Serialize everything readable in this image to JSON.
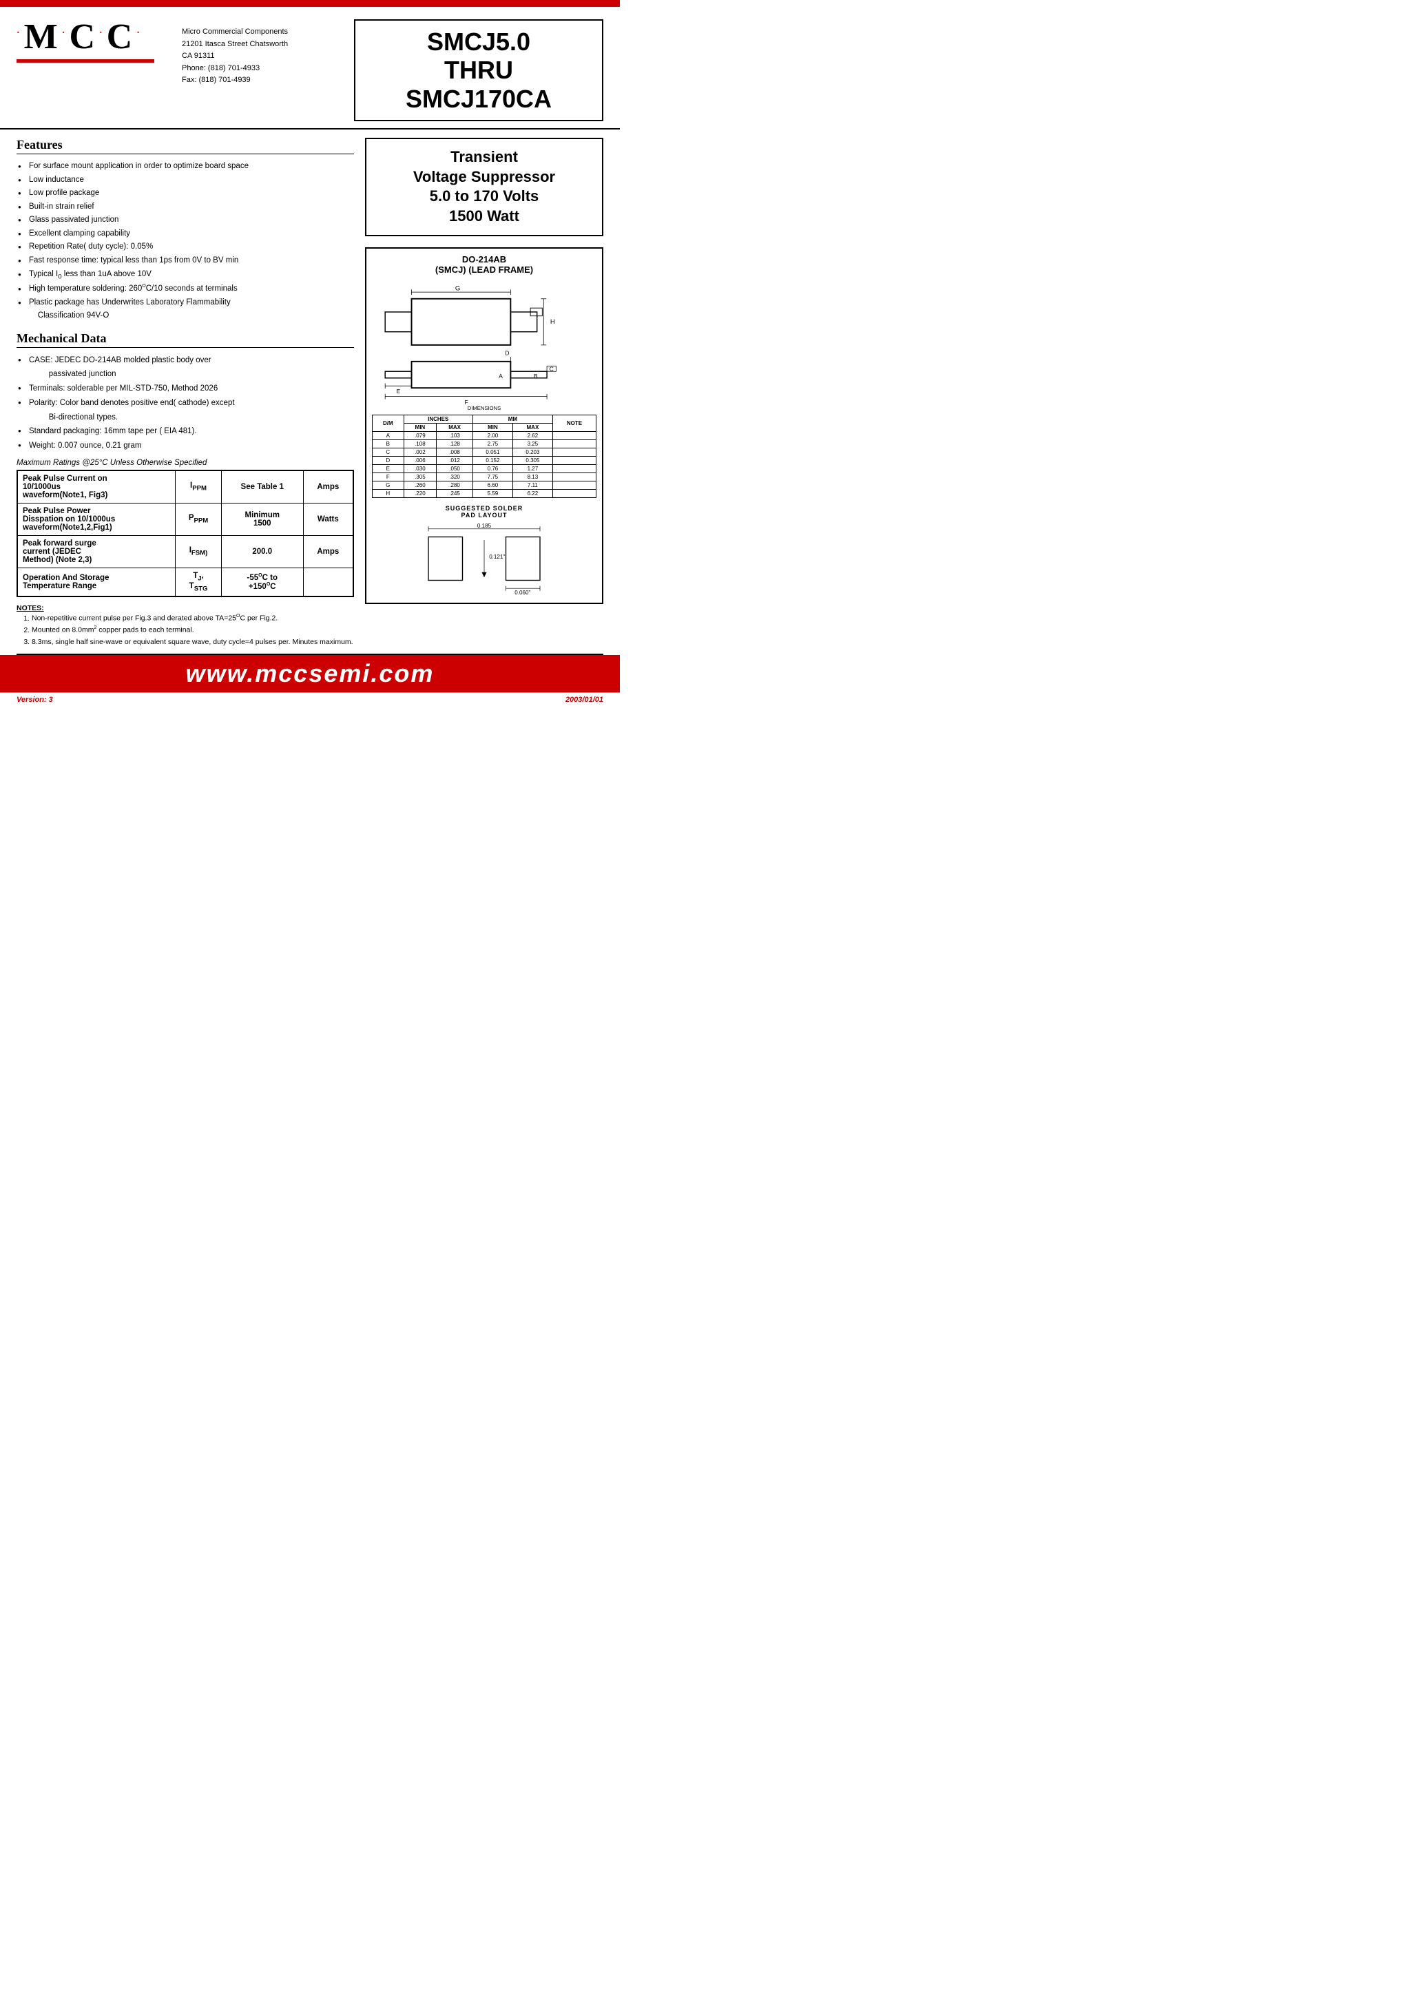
{
  "page": {
    "top_bar_color": "#cc0000",
    "logo": {
      "text": "M·C·C·"
    },
    "company": {
      "name": "Micro Commercial Components",
      "address1": "21201 Itasca Street Chatsworth",
      "address2": "CA 91311",
      "phone": "Phone: (818) 701-4933",
      "fax": "Fax:    (818) 701-4939"
    },
    "part_number": {
      "title": "SMCJ5.0\nTHRU\nSMCJ170CA"
    },
    "tvs": {
      "title": "Transient\nVoltage Suppressor\n5.0 to 170 Volts\n1500 Watt"
    },
    "package": {
      "title": "DO-214AB",
      "subtitle": "(SMCJ) (LEAD FRAME)"
    },
    "features": {
      "title": "Features",
      "items": [
        "For surface mount application in order to optimize board space",
        "Low inductance",
        "Low profile package",
        "Built-in strain relief",
        "Glass passivated junction",
        "Excellent clamping capability",
        "Repetition Rate( duty cycle): 0.05%",
        "Fast response time: typical less than 1ps from 0V to BV min",
        "Typical I₀ less than 1uA above 10V",
        "High temperature soldering: 260°C/10 seconds at terminals",
        "Plastic package has Underwrites Laboratory Flammability Classification 94V-O"
      ]
    },
    "mechanical": {
      "title": "Mechanical Data",
      "items": [
        "CASE: JEDEC DO-214AB molded plastic body over passivated junction",
        "Terminals:  solderable per MIL-STD-750, Method 2026",
        "Polarity: Color band denotes positive end( cathode) except Bi-directional types.",
        "Standard packaging: 16mm tape per ( EIA 481).",
        "Weight: 0.007 ounce, 0.21 gram"
      ]
    },
    "max_ratings_header": "Maximum Ratings @25°C Unless Otherwise Specified",
    "ratings_table": {
      "rows": [
        {
          "label1": "Peak Pulse Current on",
          "label2": "10/1000us",
          "label3": "waveform(Note1, Fig3)",
          "symbol": "Iₚₚₘ",
          "value": "See Table 1",
          "unit": "Amps"
        },
        {
          "label1": "Peak Pulse Power",
          "label2": "Disspation on 10/1000us",
          "label3": "waveform(Note1,2,Fig1)",
          "symbol": "Pₚₚₘ",
          "value": "Minimum\n1500",
          "unit": "Watts"
        },
        {
          "label1": "Peak forward surge",
          "label2": "current (JEDEC",
          "label3": "Method) (Note 2,3)",
          "symbol": "Iₜₛₘ₍",
          "value": "200.0",
          "unit": "Amps"
        },
        {
          "label1": "Operation And Storage",
          "label2": "Temperature Range",
          "label3": "",
          "symbol": "Tⱼ,\nTₛₜᵍ",
          "value": "-55°C to\n+150°C",
          "unit": ""
        }
      ]
    },
    "notes": {
      "title": "NOTES:",
      "items": [
        "Non-repetitive current pulse per Fig.3 and derated above TA=25°C per Fig.2.",
        "Mounted on 8.0mm² copper pads to each terminal.",
        "8.3ms, single half sine-wave or equivalent square wave, duty cycle=4 pulses per. Minutes maximum."
      ]
    },
    "dimensions_table": {
      "headers": [
        "D/M",
        "INCHES MIN",
        "INCHES MAX",
        "MM MIN",
        "MM MAX",
        "NOTE"
      ],
      "rows": [
        [
          "A",
          ".079",
          ".103",
          "2.00",
          "2.62",
          ""
        ],
        [
          "B",
          ".108",
          ".128",
          "2.75",
          "3.25",
          ""
        ],
        [
          "C",
          ".002",
          ".008",
          "0.051",
          "0.203",
          ""
        ],
        [
          "D",
          ".006",
          ".012",
          "0.152",
          "0.305",
          ""
        ],
        [
          "E",
          ".030",
          ".050",
          "0.76",
          "1.27",
          ""
        ],
        [
          "F",
          ".305",
          ".320",
          "7.75",
          "8.13",
          ""
        ],
        [
          "G",
          ".260",
          ".280",
          "6.60",
          "7.11",
          ""
        ],
        [
          "H",
          ".220",
          ".245",
          "5.59",
          "6.22",
          ""
        ]
      ]
    },
    "solder_pad": {
      "title": "SUGGESTED SOLDER\nPAD LAYOUT",
      "dim1": "0.185",
      "dim2": "0.121\"",
      "dim3": "0.060\""
    },
    "website": "www.mccsemi.com",
    "footer": {
      "version": "Version: 3",
      "date": "2003/01/01"
    }
  }
}
